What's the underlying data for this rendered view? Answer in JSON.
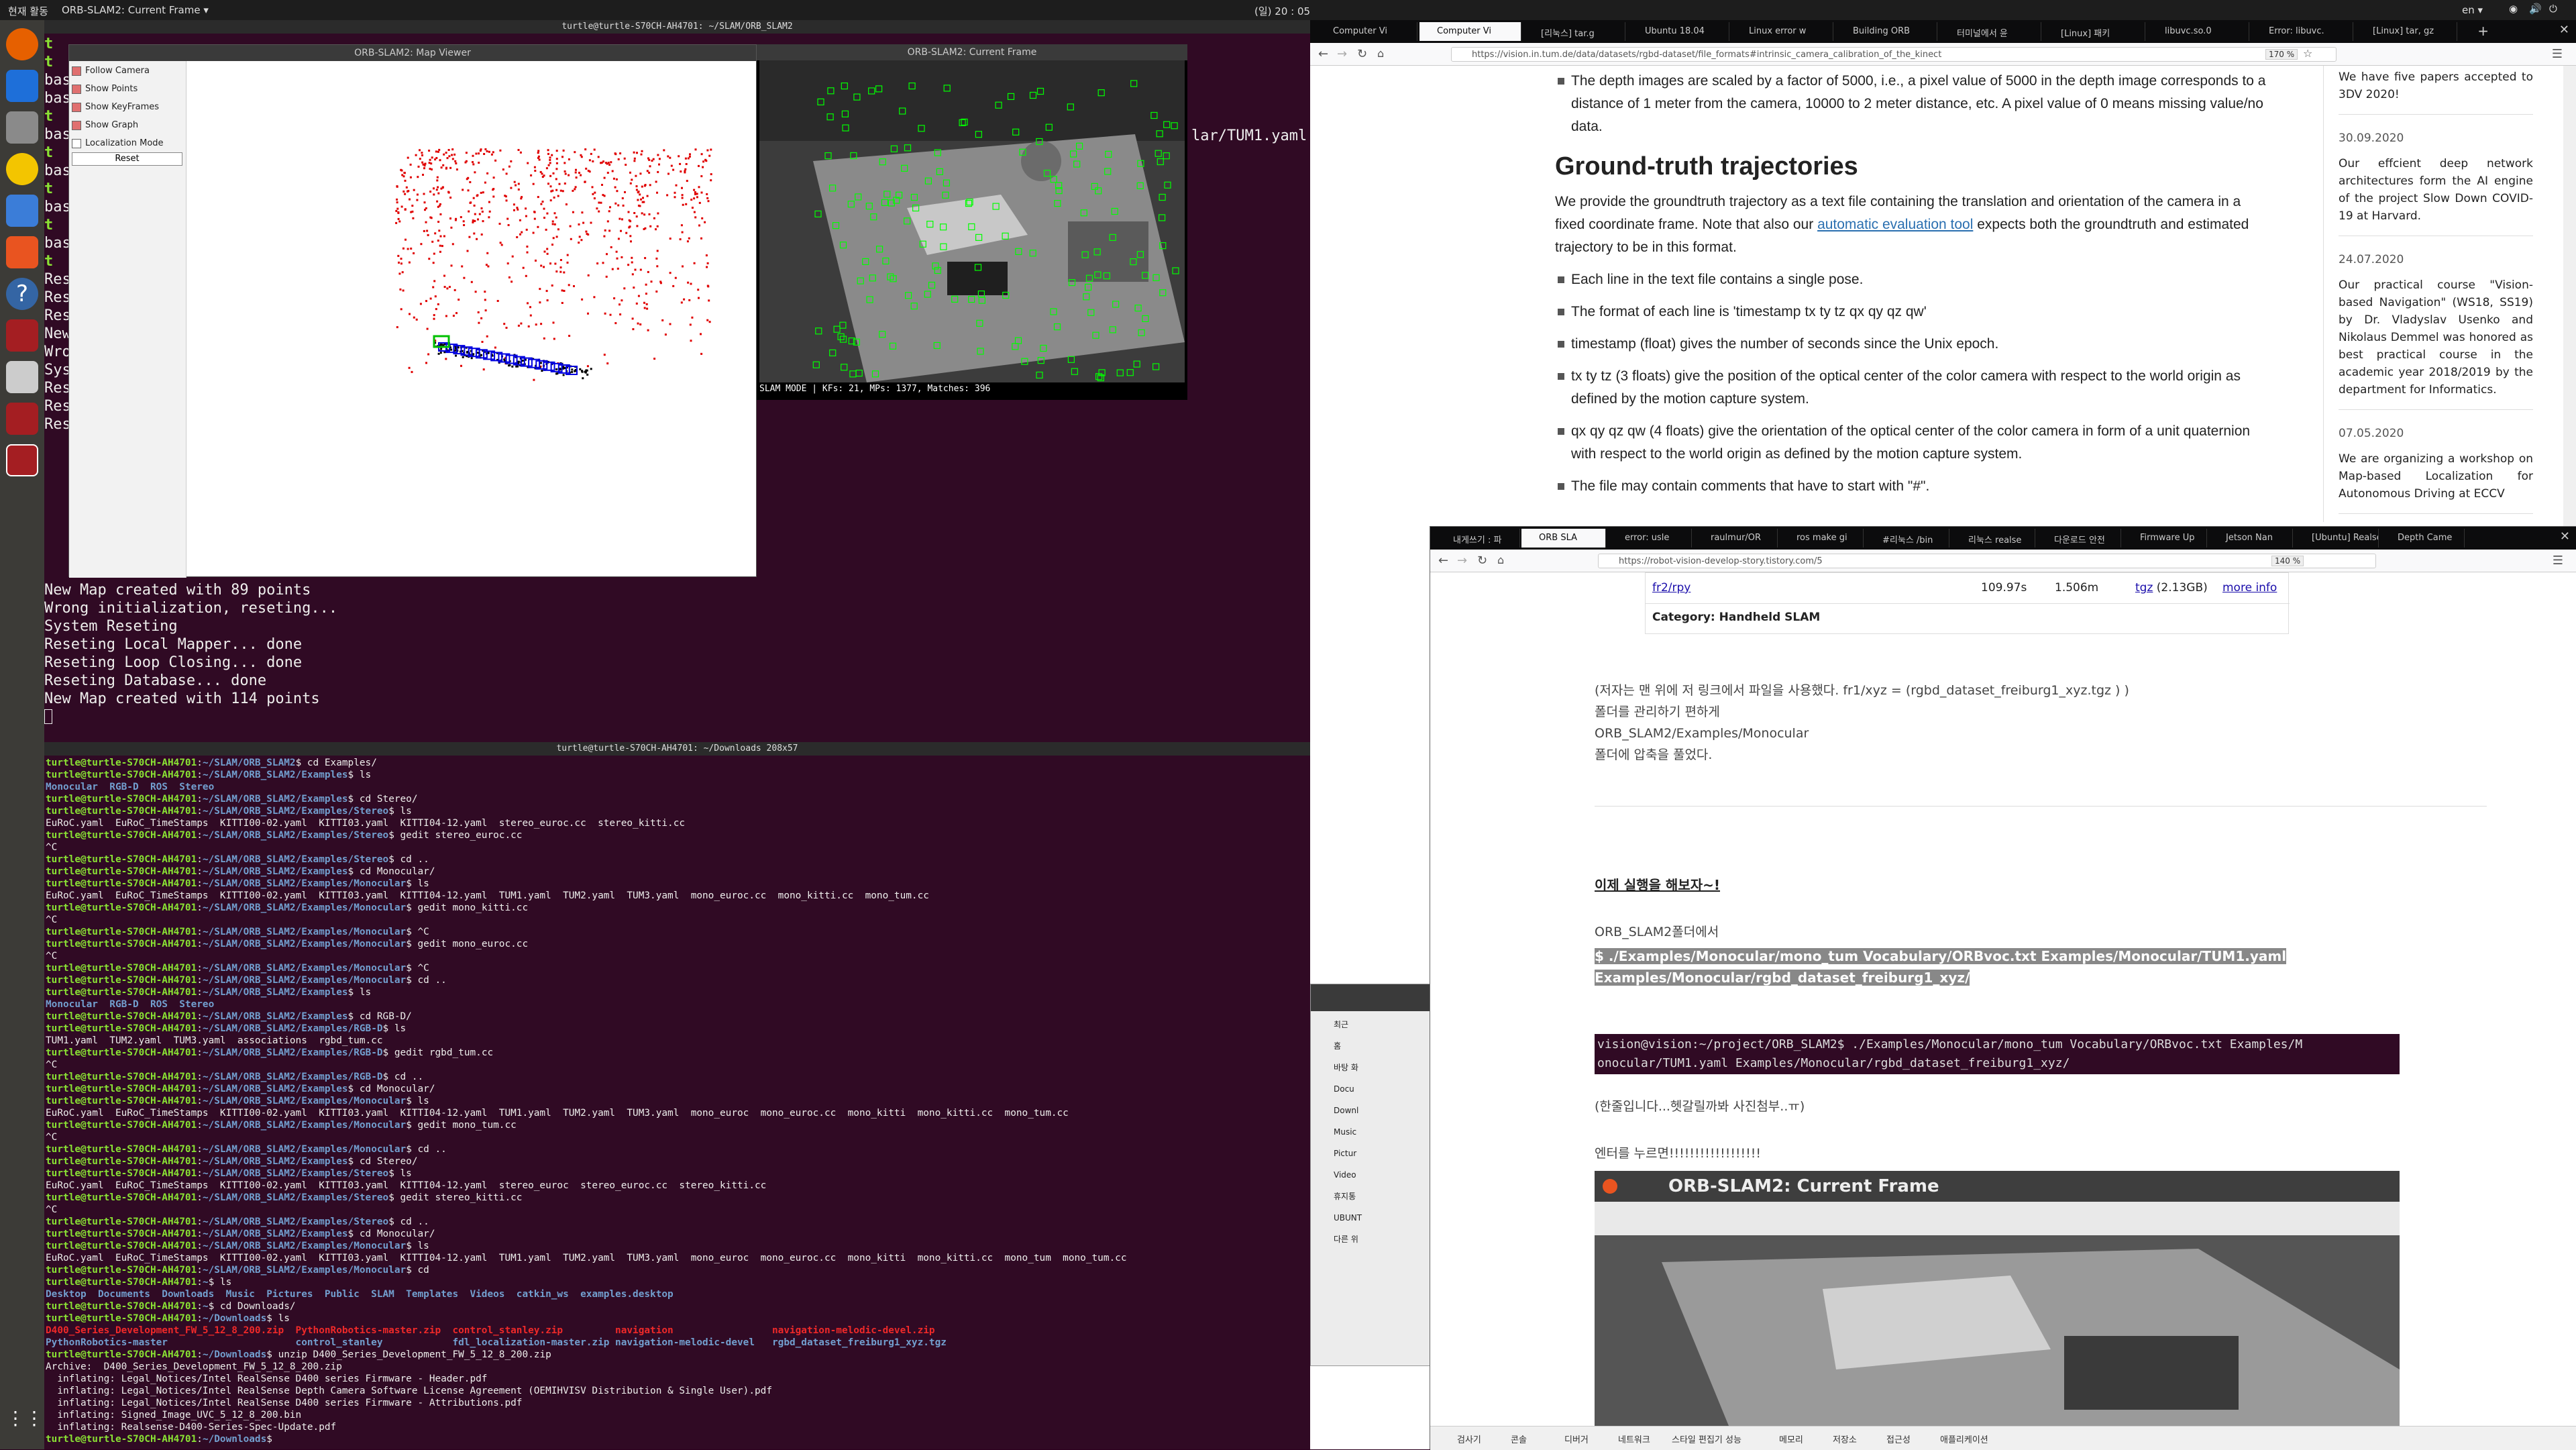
{
  "topbar": {
    "activities": "현재 활동",
    "app_menu": "ORB-SLAM2: Current Frame ▾",
    "clock": "(일) 20 : 05",
    "lang": "en ▾"
  },
  "map_viewer": {
    "title": "ORB-SLAM2: Map Viewer",
    "options": [
      {
        "label": "Follow Camera",
        "checked": true
      },
      {
        "label": "Show Points",
        "checked": true
      },
      {
        "label": "Show KeyFrames",
        "checked": true
      },
      {
        "label": "Show Graph",
        "checked": true
      },
      {
        "label": "Localization Mode",
        "checked": false
      }
    ],
    "reset_label": "Reset"
  },
  "current_frame": {
    "title": "ORB-SLAM2: Current Frame",
    "status": "SLAM MODE |  KFs: 21, MPs: 1377, Matches: 396"
  },
  "term1": {
    "title": "turtle@turtle-S70CH-AH4701: ~/SLAM/ORB_SLAM2",
    "right_text": "lar/TUM1.yaml",
    "left_column": [
      "t",
      "t",
      "bas",
      "bas",
      "t",
      "bas",
      "t",
      "bas",
      "t",
      "bas",
      "t",
      "bas",
      "t",
      "Res",
      "Res",
      "Res",
      "New",
      "Wro",
      "Sys",
      "Res",
      "Res",
      "Res"
    ],
    "lines": [
      "New Map created with 89 points",
      "Wrong initialization, reseting...",
      "System Reseting",
      "Reseting Local Mapper... done",
      "Reseting Loop Closing... done",
      "Reseting Database... done",
      "New Map created with 114 points"
    ]
  },
  "term2": {
    "title": "turtle@turtle-S70CH-AH4701: ~/Downloads 208x57",
    "lines": [
      {
        "p": "turtle@turtle-S70CH-AH4701",
        "d": "~/SLAM/ORB_SLAM2",
        "c": "$ cd Examples/"
      },
      {
        "p": "turtle@turtle-S70CH-AH4701",
        "d": "~/SLAM/ORB_SLAM2/Examples",
        "c": "$ ls"
      },
      {
        "o": "Monocular  RGB-D  ROS  Stereo",
        "cls": "dir"
      },
      {
        "p": "turtle@turtle-S70CH-AH4701",
        "d": "~/SLAM/ORB_SLAM2/Examples",
        "c": "$ cd Stereo/"
      },
      {
        "p": "turtle@turtle-S70CH-AH4701",
        "d": "~/SLAM/ORB_SLAM2/Examples/Stereo",
        "c": "$ ls"
      },
      {
        "o": "EuRoC.yaml  EuRoC_TimeStamps  KITTI00-02.yaml  KITTI03.yaml  KITTI04-12.yaml  stereo_euroc.cc  stereo_kitti.cc"
      },
      {
        "p": "turtle@turtle-S70CH-AH4701",
        "d": "~/SLAM/ORB_SLAM2/Examples/Stereo",
        "c": "$ gedit stereo_euroc.cc"
      },
      {
        "o": "^C"
      },
      {
        "p": "turtle@turtle-S70CH-AH4701",
        "d": "~/SLAM/ORB_SLAM2/Examples/Stereo",
        "c": "$ cd .."
      },
      {
        "p": "turtle@turtle-S70CH-AH4701",
        "d": "~/SLAM/ORB_SLAM2/Examples",
        "c": "$ cd Monocular/"
      },
      {
        "p": "turtle@turtle-S70CH-AH4701",
        "d": "~/SLAM/ORB_SLAM2/Examples/Monocular",
        "c": "$ ls"
      },
      {
        "o": "EuRoC.yaml  EuRoC_TimeStamps  KITTI00-02.yaml  KITTI03.yaml  KITTI04-12.yaml  TUM1.yaml  TUM2.yaml  TUM3.yaml  mono_euroc.cc  mono_kitti.cc  mono_tum.cc"
      },
      {
        "p": "turtle@turtle-S70CH-AH4701",
        "d": "~/SLAM/ORB_SLAM2/Examples/Monocular",
        "c": "$ gedit mono_kitti.cc"
      },
      {
        "o": "^C"
      },
      {
        "p": "turtle@turtle-S70CH-AH4701",
        "d": "~/SLAM/ORB_SLAM2/Examples/Monocular",
        "c": "$ ^C"
      },
      {
        "p": "turtle@turtle-S70CH-AH4701",
        "d": "~/SLAM/ORB_SLAM2/Examples/Monocular",
        "c": "$ gedit mono_euroc.cc"
      },
      {
        "o": "^C"
      },
      {
        "p": "turtle@turtle-S70CH-AH4701",
        "d": "~/SLAM/ORB_SLAM2/Examples/Monocular",
        "c": "$ ^C"
      },
      {
        "p": "turtle@turtle-S70CH-AH4701",
        "d": "~/SLAM/ORB_SLAM2/Examples/Monocular",
        "c": "$ cd .."
      },
      {
        "p": "turtle@turtle-S70CH-AH4701",
        "d": "~/SLAM/ORB_SLAM2/Examples",
        "c": "$ ls"
      },
      {
        "o": "Monocular  RGB-D  ROS  Stereo",
        "cls": "dir"
      },
      {
        "p": "turtle@turtle-S70CH-AH4701",
        "d": "~/SLAM/ORB_SLAM2/Examples",
        "c": "$ cd RGB-D/"
      },
      {
        "p": "turtle@turtle-S70CH-AH4701",
        "d": "~/SLAM/ORB_SLAM2/Examples/RGB-D",
        "c": "$ ls"
      },
      {
        "o": "TUM1.yaml  TUM2.yaml  TUM3.yaml  associations  rgbd_tum.cc"
      },
      {
        "p": "turtle@turtle-S70CH-AH4701",
        "d": "~/SLAM/ORB_SLAM2/Examples/RGB-D",
        "c": "$ gedit rgbd_tum.cc"
      },
      {
        "o": "^C"
      },
      {
        "p": "turtle@turtle-S70CH-AH4701",
        "d": "~/SLAM/ORB_SLAM2/Examples/RGB-D",
        "c": "$ cd .."
      },
      {
        "p": "turtle@turtle-S70CH-AH4701",
        "d": "~/SLAM/ORB_SLAM2/Examples",
        "c": "$ cd Monocular/"
      },
      {
        "p": "turtle@turtle-S70CH-AH4701",
        "d": "~/SLAM/ORB_SLAM2/Examples/Monocular",
        "c": "$ ls"
      },
      {
        "o": "EuRoC.yaml  EuRoC_TimeStamps  KITTI00-02.yaml  KITTI03.yaml  KITTI04-12.yaml  TUM1.yaml  TUM2.yaml  TUM3.yaml  mono_euroc  mono_euroc.cc  mono_kitti  mono_kitti.cc  mono_tum.cc"
      },
      {
        "p": "turtle@turtle-S70CH-AH4701",
        "d": "~/SLAM/ORB_SLAM2/Examples/Monocular",
        "c": "$ gedit mono_tum.cc"
      },
      {
        "o": "^C"
      },
      {
        "p": "turtle@turtle-S70CH-AH4701",
        "d": "~/SLAM/ORB_SLAM2/Examples/Monocular",
        "c": "$ cd .."
      },
      {
        "p": "turtle@turtle-S70CH-AH4701",
        "d": "~/SLAM/ORB_SLAM2/Examples",
        "c": "$ cd Stereo/"
      },
      {
        "p": "turtle@turtle-S70CH-AH4701",
        "d": "~/SLAM/ORB_SLAM2/Examples/Stereo",
        "c": "$ ls"
      },
      {
        "o": "EuRoC.yaml  EuRoC_TimeStamps  KITTI00-02.yaml  KITTI03.yaml  KITTI04-12.yaml  stereo_euroc  stereo_euroc.cc  stereo_kitti.cc"
      },
      {
        "p": "turtle@turtle-S70CH-AH4701",
        "d": "~/SLAM/ORB_SLAM2/Examples/Stereo",
        "c": "$ gedit stereo_kitti.cc"
      },
      {
        "o": "^C"
      },
      {
        "p": "turtle@turtle-S70CH-AH4701",
        "d": "~/SLAM/ORB_SLAM2/Examples/Stereo",
        "c": "$ cd .."
      },
      {
        "p": "turtle@turtle-S70CH-AH4701",
        "d": "~/SLAM/ORB_SLAM2/Examples",
        "c": "$ cd Monocular/"
      },
      {
        "p": "turtle@turtle-S70CH-AH4701",
        "d": "~/SLAM/ORB_SLAM2/Examples/Monocular",
        "c": "$ ls"
      },
      {
        "o": "EuRoC.yaml  EuRoC_TimeStamps  KITTI00-02.yaml  KITTI03.yaml  KITTI04-12.yaml  TUM1.yaml  TUM2.yaml  TUM3.yaml  mono_euroc  mono_euroc.cc  mono_kitti  mono_kitti.cc  mono_tum  mono_tum.cc"
      },
      {
        "p": "turtle@turtle-S70CH-AH4701",
        "d": "~/SLAM/ORB_SLAM2/Examples/Monocular",
        "c": "$ cd"
      },
      {
        "p": "turtle@turtle-S70CH-AH4701",
        "d": "~",
        "c": "$ ls"
      },
      {
        "o": "Desktop  Documents  Downloads  Music  Pictures  Public  SLAM  Templates  Videos  catkin_ws  examples.desktop",
        "cls": "dir"
      },
      {
        "p": "turtle@turtle-S70CH-AH4701",
        "d": "~",
        "c": "$ cd Downloads/"
      },
      {
        "p": "turtle@turtle-S70CH-AH4701",
        "d": "~/Downloads",
        "c": "$ ls"
      },
      {
        "o": "D400_Series_Development_FW_5_12_8_200.zip  PythonRobotics-master.zip  control_stanley.zip         navigation                 navigation-melodic-devel.zip",
        "cls": "zipf"
      },
      {
        "o": "PythonRobotics-master                      control_stanley            fdl_localization-master.zip navigation-melodic-devel   rgbd_dataset_freiburg1_xyz.tgz",
        "cls": "dir"
      },
      {
        "p": "turtle@turtle-S70CH-AH4701",
        "d": "~/Downloads",
        "c": "$ unzip D400_Series_Development_FW_5_12_8_200.zip"
      },
      {
        "o": "Archive:  D400_Series_Development_FW_5_12_8_200.zip"
      },
      {
        "o": "  inflating: Legal_Notices/Intel RealSense D400 series Firmware - Header.pdf"
      },
      {
        "o": "  inflating: Legal_Notices/Intel RealSense Depth Camera Software License Agreement (OEMIHVISV Distribution & Single User).pdf"
      },
      {
        "o": "  inflating: Legal_Notices/Intel RealSense D400 series Firmware - Attributions.pdf"
      },
      {
        "o": "  inflating: Signed_Image_UVC_5_12_8_200.bin"
      },
      {
        "o": "  inflating: Realsense-D400-Series-Spec-Update.pdf"
      },
      {
        "p": "turtle@turtle-S70CH-AH4701",
        "d": "~/Downloads",
        "c": "$ "
      }
    ]
  },
  "browser1": {
    "tabs": [
      "Computer Vi",
      "Computer Vi",
      "[리눅스] tar.g",
      "Ubuntu 18.04",
      "Linux error w",
      "Building ORB",
      "터미널에서 윤",
      "[Linux] 패키",
      "libuvc.so.0",
      "Error: libuvc.",
      "[Linux] tar, gz"
    ],
    "url": "https://vision.in.tum.de/data/datasets/rgbd-dataset/file_formats#intrinsic_camera_calibration_of_the_kinect",
    "zoom": "170 %",
    "intro_bullet": "The depth images are scaled by a factor of 5000, i.e., a pixel value of 5000 in the depth image corresponds to a distance of 1 meter from the camera, 10000 to 2 meter distance, etc. A pixel value of 0 means missing value/no data.",
    "heading": "Ground-truth trajectories",
    "para_before": "We provide the groundtruth trajectory as a text file containing the translation and orientation of the camera in a fixed coordinate frame. Note that also our",
    "para_link": "automatic evaluation tool",
    "para_after": "expects both the groundtruth and estimated trajectory to be in this format.",
    "bullets": [
      "Each line in the text file contains a single pose.",
      "The format of each line is 'timestamp tx ty tz qx qy qz qw'",
      "timestamp (float) gives the number of seconds since the Unix epoch.",
      "tx ty tz (3 floats) give the position of the optical center of the color camera with respect to the world origin as defined by the motion capture system.",
      "qx qy qz qw (4 floats) give the orientation of the optical center of the color camera in form of a unit quaternion with respect to the world origin as defined by the motion capture system.",
      "The file may contain comments that have to start with \"#\"."
    ],
    "news": [
      {
        "text": "We have five papers accepted to 3DV 2020!"
      },
      {
        "date": "30.09.2020",
        "text": "Our effcient deep network architectures form the AI engine of the project Slow Down COVID-19 at Harvard."
      },
      {
        "date": "24.07.2020",
        "text": "Our practical course \"Vision-based Navigation\" (WS18, SS19) by Dr. Vladyslav Usenko and Nikolaus Demmel was honored as best practical course in the academic year 2018/2019 by the department for Informatics."
      },
      {
        "date": "07.05.2020",
        "text": "We are organizing a workshop on Map-based Localization for Autonomous Driving at ECCV"
      }
    ]
  },
  "browser2": {
    "tabs": [
      "내게쓰기 : 파",
      "ORB SLA",
      "error: usle",
      "raulmur/OR",
      "ros make gi",
      "#리눅스 /bin",
      "리눅스 realse",
      "다운로드 안전",
      "Firmware Up",
      "Jetson Nan",
      "[Ubuntu] Realse",
      "Depth Came"
    ],
    "url": "https://robot-vision-develop-story.tistory.com/5",
    "zoom": "140 %",
    "table_row": {
      "name": "fr2/rpy",
      "duration": "109.97s",
      "length": "1.506m",
      "format": "tgz",
      "size": "(2.13GB)",
      "link": "more info"
    },
    "table_category": "Category: Handheld SLAM",
    "korean_lines": [
      "(저자는 맨 위에 저 링크에서 파일을 사용했다. fr1/xyz = (rgbd_dataset_freiburg1_xyz.tgz ) )",
      "폴더를 관리하기 편하게",
      "ORB_SLAM2/Examples/Monocular",
      "폴더에 압축을 풀었다."
    ],
    "run_heading": "이제 실행을 해보자~!",
    "run_intro": "ORB_SLAM2폴더에서",
    "command_line": "$ ./Examples/Monocular/mono_tum Vocabulary/ORBvoc.txt Examples/Monocular/TUM1.yaml Examples/Monocular/rgbd_dataset_freiburg1_xyz/",
    "term_snip1": "vision@vision:~/project/ORB_SLAM2$ ./Examples/Monocular/mono_tum Vocabulary/ORBvoc.txt Examples/M",
    "term_snip2": "onocular/TUM1.yaml Examples/Monocular/rgbd_dataset_freiburg1_xyz/",
    "note": "(한줄입니다...헷갈릴까봐 사진첨부..ㅠ)",
    "enter_text": "엔터를 누르면!!!!!!!!!!!!!!!!!!",
    "embedded_title": "ORB-SLAM2: Current Frame",
    "status_items": [
      "검사기",
      "콘솔",
      "디버거",
      "네트워크",
      "스타일 편집기",
      "성능",
      "메모리",
      "저장소",
      "접근성",
      "애플리케이션"
    ]
  },
  "files_window": {
    "items": [
      "최근",
      "홈",
      "바탕 화",
      "Docu",
      "Downl",
      "Music",
      "Pictur",
      "Video",
      "휴지통",
      "UBUNT",
      "다른 위"
    ]
  }
}
